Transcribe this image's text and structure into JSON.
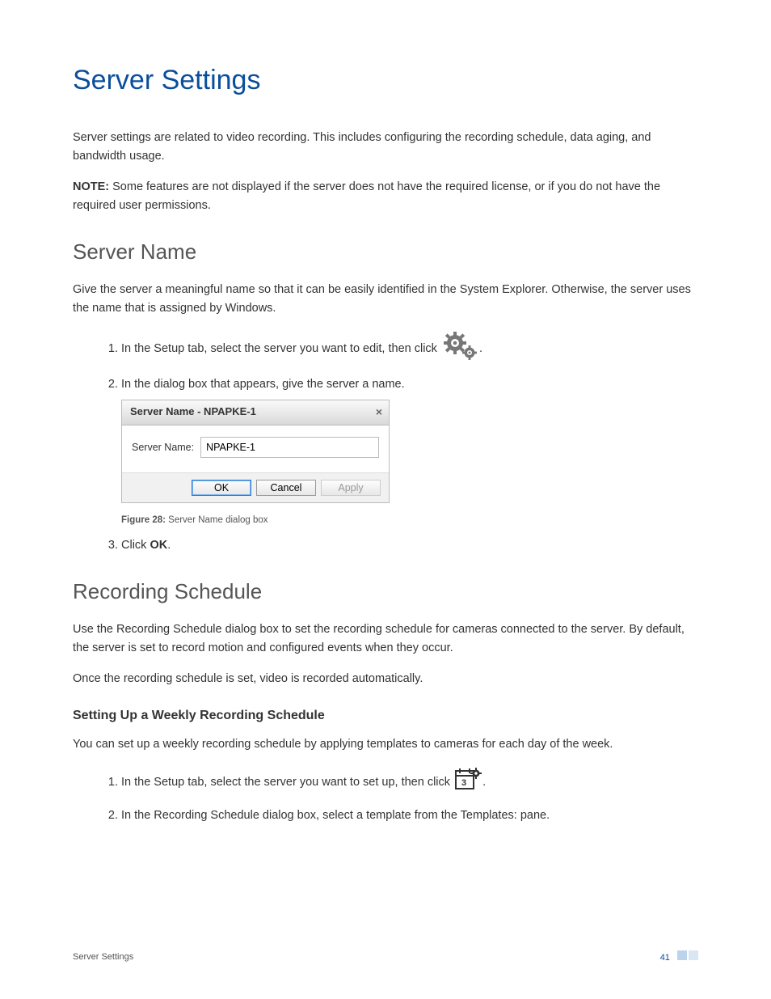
{
  "h1": "Server Settings",
  "intro": "Server settings are related to video recording. This includes configuring the recording schedule, data aging, and bandwidth usage.",
  "note_label": "NOTE:",
  "note": " Some features are not displayed if the server does not have the required license, or if you do not have the required user permissions.",
  "section1": {
    "title": "Server Name",
    "p1": "Give the server a meaningful name so that it can be easily identified in the System Explorer. Otherwise, the server uses the name that is assigned by Windows.",
    "li1": "In the Setup tab, select the server you want to edit, then click ",
    "li1_end": ".",
    "li2": "In the dialog box that appears, give the server a name.",
    "dialog": {
      "title": "Server Name - NPAPKE-1",
      "field_label": "Server Name:",
      "field_value": "NPAPKE-1",
      "ok": "OK",
      "cancel": "Cancel",
      "apply": "Apply"
    },
    "figcap_label": "Figure 28:",
    "figcap": " Server Name dialog box",
    "li3_a": "Click ",
    "li3_b": "OK",
    "li3_c": "."
  },
  "section2": {
    "title": "Recording Schedule",
    "p1": "Use the Recording Schedule dialog box to set the recording schedule for cameras connected to the server. By default, the server is set to record motion and configured events when they occur.",
    "p2": "Once the recording schedule is set, video is recorded automatically.",
    "sub_title": "Setting Up a Weekly Recording Schedule",
    "p3": "You can set up a weekly recording schedule by applying templates to cameras for each day of the week.",
    "li1": "In the Setup tab, select the server you want to set up, then click ",
    "li1_end": ".",
    "li2": "In the Recording Schedule dialog box, select a template from the Templates: pane."
  },
  "footer": {
    "left": "Server Settings",
    "page": "41"
  }
}
